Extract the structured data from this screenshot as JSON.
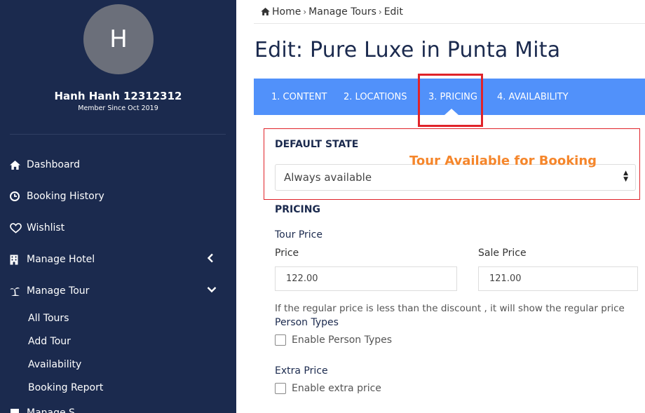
{
  "sidebar": {
    "avatar_letter": "H",
    "user_name": "Hanh Hanh 12312312",
    "member_since": "Member Since Oct 2019",
    "items": [
      {
        "label": "Dashboard",
        "icon": "home-icon"
      },
      {
        "label": "Booking History",
        "icon": "clock-icon"
      },
      {
        "label": "Wishlist",
        "icon": "heart-icon"
      },
      {
        "label": "Manage Hotel",
        "icon": "building-icon"
      },
      {
        "label": "Manage Tour",
        "icon": "island-icon"
      }
    ],
    "sub_items": [
      "All Tours",
      "Add Tour",
      "Availability",
      "Booking Report"
    ],
    "cut_item": "Manage S"
  },
  "breadcrumb": [
    "Home",
    "Manage Tours",
    "Edit"
  ],
  "page_title": "Edit: Pure Luxe in Punta Mita",
  "tabs": [
    "1. CONTENT",
    "2. LOCATIONS",
    "3. PRICING",
    "4. AVAILABILITY"
  ],
  "active_tab": "3. PRICING",
  "default_state": {
    "heading": "DEFAULT STATE",
    "annotation": "Tour Available for Booking",
    "selected": "Always available"
  },
  "pricing": {
    "heading": "PRICING",
    "tour_price_label": "Tour Price",
    "price_label": "Price",
    "price_value": "122.00",
    "sale_price_label": "Sale Price",
    "sale_price_value": "121.00",
    "note": "If the regular price is less than the discount , it will show the regular price",
    "person_types_label": "Person Types",
    "enable_person_types": "Enable Person Types",
    "extra_price_label": "Extra Price",
    "enable_extra_price": "Enable extra price"
  },
  "colors": {
    "sidebar_bg": "#1b2a4e",
    "tab_bar": "#5191fa",
    "highlight": "#e0232a",
    "annotation": "#f5862b"
  }
}
